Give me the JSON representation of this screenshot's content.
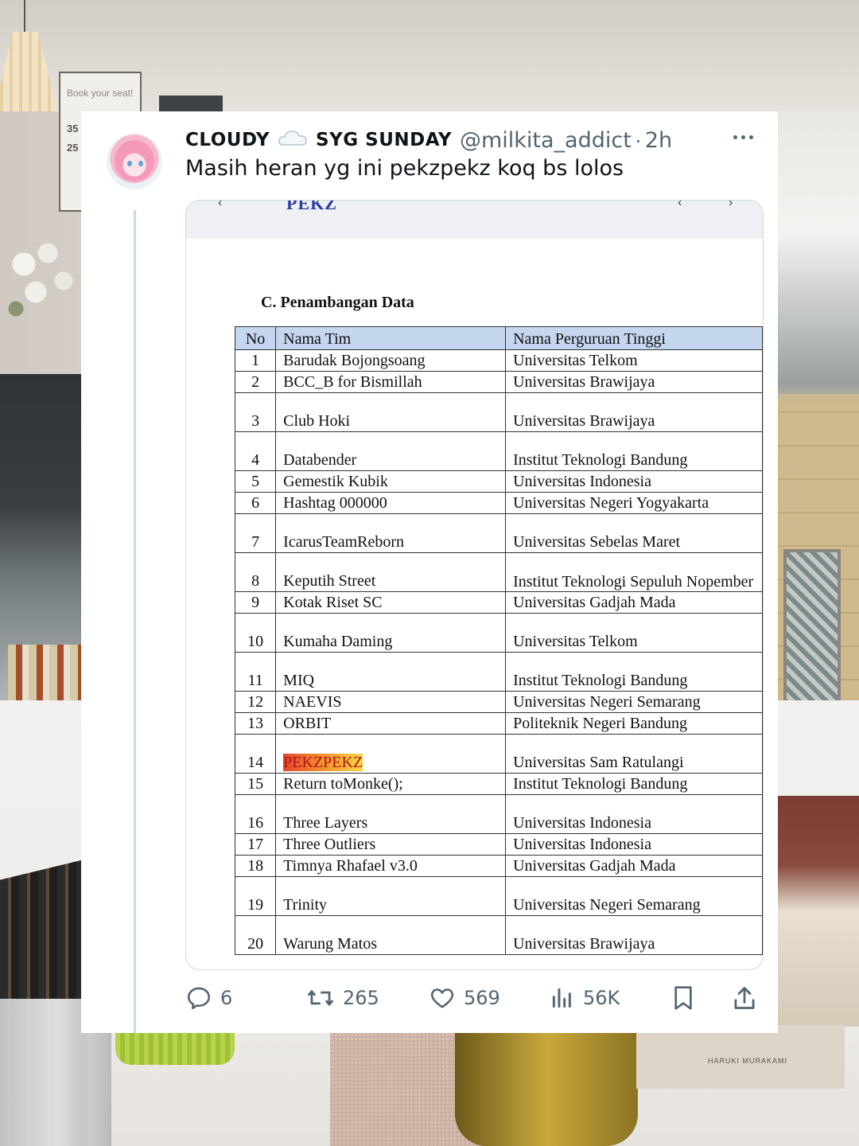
{
  "background": {
    "sign_title": "Book your seat!",
    "sign_numbers": [
      "35",
      "25"
    ],
    "book_title": "HARUKI MURAKAMI"
  },
  "tweet": {
    "display_name": "CLOUDY",
    "display_name_suffix": "SYG SUNDAY",
    "handle": "@milkita_addict",
    "separator": "·",
    "time": "2h",
    "text": "Masih heran yg ini pekzpekz koq bs lolos",
    "colors": {
      "text": "#0f1419",
      "secondary": "#536471",
      "border": "#cfd9de"
    }
  },
  "document": {
    "top_fragment": "PEKZ",
    "section_heading": "C.  Penambangan Data",
    "columns": [
      "No",
      "Nama Tim",
      "Nama Perguruan Tinggi"
    ],
    "rows": [
      {
        "no": "1",
        "team": "Barudak Bojongsoang",
        "university": "Universitas Telkom"
      },
      {
        "no": "2",
        "team": "BCC_B for Bismillah",
        "university": "Universitas Brawijaya"
      },
      {
        "no": "3",
        "team": "Club Hoki",
        "university": "Universitas Brawijaya"
      },
      {
        "no": "4",
        "team": "Databender",
        "university": "Institut Teknologi Bandung"
      },
      {
        "no": "5",
        "team": "Gemestik Kubik",
        "university": "Universitas Indonesia"
      },
      {
        "no": "6",
        "team": "Hashtag 000000",
        "university": "Universitas Negeri Yogyakarta"
      },
      {
        "no": "7",
        "team": "IcarusTeamReborn",
        "university": "Universitas Sebelas Maret"
      },
      {
        "no": "8",
        "team": "Keputih Street",
        "university": "Institut Teknologi Sepuluh Nopember"
      },
      {
        "no": "9",
        "team": "Kotak Riset SC",
        "university": "Universitas Gadjah Mada"
      },
      {
        "no": "10",
        "team": "Kumaha Daming",
        "university": "Universitas Telkom"
      },
      {
        "no": "11",
        "team": "MIQ",
        "university": "Institut Teknologi Bandung"
      },
      {
        "no": "12",
        "team": "NAEVIS",
        "university": "Universitas Negeri Semarang"
      },
      {
        "no": "13",
        "team": "ORBIT",
        "university": "Politeknik Negeri Bandung"
      },
      {
        "no": "14",
        "team": "PEKZPEKZ",
        "university": "Universitas Sam Ratulangi"
      },
      {
        "no": "15",
        "team": "Return toMonke();",
        "university": "Institut Teknologi Bandung"
      },
      {
        "no": "16",
        "team": "Three Layers",
        "university": "Universitas Indonesia"
      },
      {
        "no": "17",
        "team": "Three Outliers",
        "university": "Universitas Indonesia"
      },
      {
        "no": "18",
        "team": "Timnya Rhafael v3.0",
        "university": "Universitas Gadjah Mada"
      },
      {
        "no": "19",
        "team": "Trinity",
        "university": "Universitas Negeri Semarang"
      },
      {
        "no": "20",
        "team": "Warung Matos",
        "university": "Universitas Brawijaya"
      }
    ],
    "highlighted_row_no": "14"
  },
  "actions": {
    "replies": "6",
    "retweets": "265",
    "likes": "569",
    "views": "56K"
  }
}
